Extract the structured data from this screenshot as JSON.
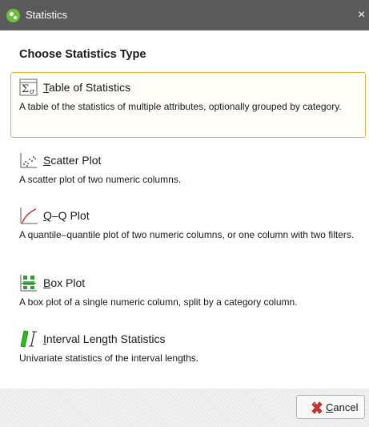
{
  "window": {
    "title": "Statistics",
    "close_glyph": "×"
  },
  "heading": "Choose Statistics Type",
  "options": [
    {
      "mnemonic": "T",
      "rest": "able of Statistics",
      "description": "A table of the statistics of multiple attributes, optionally grouped by category.",
      "icon": "sigma-table-icon",
      "selected": true
    },
    {
      "mnemonic": "S",
      "rest": "catter Plot",
      "description": "A scatter plot of two numeric columns.",
      "icon": "scatter-plot-icon",
      "selected": false
    },
    {
      "mnemonic": "Q",
      "rest": "–Q Plot",
      "description": "A quantile–quantile plot of two numeric columns, or one column with two filters.",
      "icon": "qq-plot-icon",
      "selected": false
    },
    {
      "mnemonic": "B",
      "rest": "ox Plot",
      "description": "A box plot of a single numeric column, split by a category column.",
      "icon": "box-plot-icon",
      "selected": false
    },
    {
      "mnemonic": "I",
      "rest": "nterval Length Statistics",
      "description": "Univariate statistics of the interval lengths.",
      "icon": "interval-length-icon",
      "selected": false
    }
  ],
  "footer": {
    "cancel_mnemonic": "C",
    "cancel_rest": "ancel"
  },
  "colors": {
    "titlebar": "#5a5a5a",
    "selected_border": "#e8b23a",
    "app_icon": "#6cbf3a",
    "cancel_icon": "#d9342b",
    "interval_icon": "#22c414"
  }
}
